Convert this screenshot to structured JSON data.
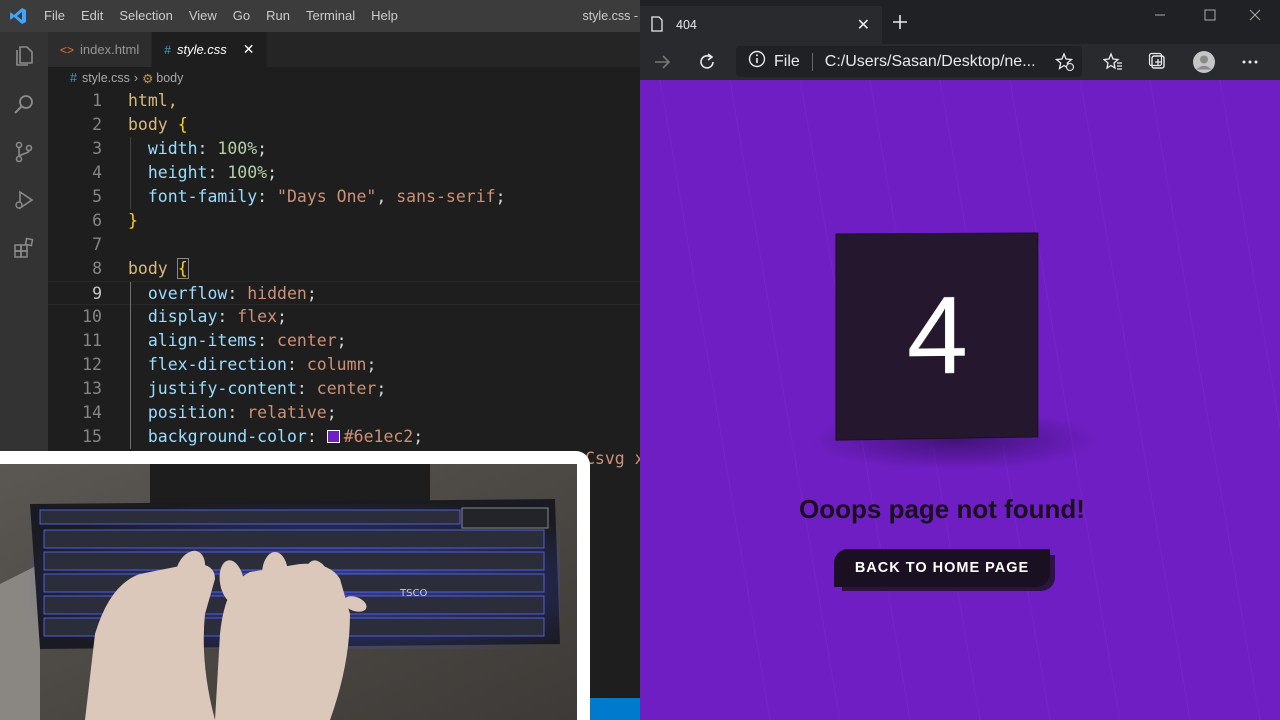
{
  "vscode": {
    "menu": [
      "File",
      "Edit",
      "Selection",
      "View",
      "Go",
      "Run",
      "Terminal",
      "Help"
    ],
    "window_title": "style.css -",
    "tabs": [
      {
        "label": "index.html",
        "icon": "html-file-icon"
      },
      {
        "label": "style.css",
        "icon": "css-file-icon"
      }
    ],
    "breadcrumb": {
      "file": "style.css",
      "symbol": "body"
    },
    "line_numbers": [
      "1",
      "2",
      "3",
      "4",
      "5",
      "6",
      "7",
      "8",
      "9",
      "10",
      "11",
      "12",
      "13",
      "14",
      "15"
    ],
    "code": {
      "l1": "html,",
      "l2_sel": "body",
      "l2_brace": "{",
      "l3_prop": "width",
      "l3_val": "100%",
      "l4_prop": "height",
      "l4_val": "100%",
      "l5_prop": "font-family",
      "l5_str": "\"Days One\"",
      "l5_val": "sans-serif",
      "l6": "}",
      "l8_sel": "body",
      "l8_brace": "{",
      "l9_prop": "overflow",
      "l9_val": "hidden",
      "l10_prop": "display",
      "l10_val": "flex",
      "l11_prop": "align-items",
      "l11_val": "center",
      "l12_prop": "flex-direction",
      "l12_val": "column",
      "l13_prop": "justify-content",
      "l13_val": "center",
      "l14_prop": "position",
      "l14_val": "relative",
      "l15_prop": "background-color",
      "l15_val": "#6e1ec2"
    },
    "overflow_text": "Csvg x"
  },
  "browser": {
    "tab_title": "404",
    "address_label": "File",
    "url": "C:/Users/Sasan/Desktop/ne...",
    "page": {
      "digit": "4",
      "message": "Ooops page not found!",
      "button": "BACK TO HOME PAGE"
    }
  },
  "colors": {
    "page_bg": "#6e1ec2",
    "card_bg": "#24172e",
    "vscode_bg": "#1e1e1e",
    "accent": "#007acc"
  }
}
